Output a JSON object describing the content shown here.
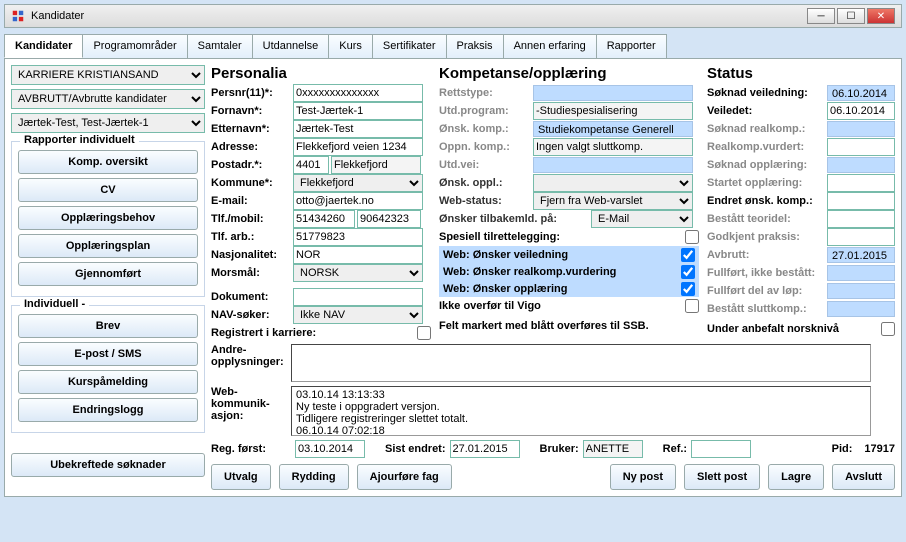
{
  "window": {
    "title": "Kandidater"
  },
  "tabs": [
    "Kandidater",
    "Programområder",
    "Samtaler",
    "Utdannelse",
    "Kurs",
    "Sertifikater",
    "Praksis",
    "Annen erfaring",
    "Rapporter"
  ],
  "active_tab": 0,
  "left_selects": [
    "KARRIERE KRISTIANSAND",
    "AVBRUTT/Avbrutte kandidater",
    "Jærtek-Test, Test-Jærtek-1"
  ],
  "report_group": {
    "title": "Rapporter individuelt",
    "buttons": [
      "Komp. oversikt",
      "CV",
      "Opplæringsbehov",
      "Opplæringsplan",
      "Gjennomført"
    ]
  },
  "indiv_group": {
    "title": "Individuell -",
    "buttons": [
      "Brev",
      "E-post / SMS",
      "Kurspåmelding",
      "Endringslogg"
    ]
  },
  "ubekreft_btn": "Ubekreftede søknader",
  "personalia": {
    "title": "Personalia",
    "persnr_label": "Persnr(11)*:",
    "persnr": "0xxxxxxxxxxxxxx",
    "fornavn_label": "Fornavn*:",
    "fornavn": "Test-Jærtek-1",
    "etternavn_label": "Etternavn*:",
    "etternavn": "Jærtek-Test",
    "adresse_label": "Adresse:",
    "adresse": "Flekkefjord veien 1234",
    "postadr_label": "Postadr.*:",
    "postnr": "4401",
    "poststed": "Flekkefjord",
    "kommune_label": "Kommune*:",
    "kommune": "Flekkefjord",
    "email_label": "E-mail:",
    "email": "otto@jaertek.no",
    "tlfmobil_label": "Tlf./mobil:",
    "tlf": "51434260",
    "mobil": "90642323",
    "tlfarb_label": "Tlf. arb.:",
    "tlfarb": "51779823",
    "nasj_label": "Nasjonalitet:",
    "nasj": "NOR",
    "morsmal_label": "Morsmål:",
    "morsmal": "NORSK",
    "dokument_label": "Dokument:",
    "dokument": "",
    "nav_label": "NAV-søker:",
    "nav": "Ikke NAV",
    "reg_label": "Registrert i karriere:",
    "andre_label1": "Andre-",
    "andre_label2": "opplysninger:",
    "andre": "",
    "web_label1": "Web-",
    "web_label2": "kommunik-",
    "web_label3": "asjon:",
    "web_text": "03.10.14 13:13:33\nNy teste i oppgradert versjon.\nTidligere registreringer slettet totalt.\n06.10.14 07:02:18"
  },
  "kompetanse": {
    "title": "Kompetanse/opplæring",
    "rettstype_label": "Rettstype:",
    "utdprogram_label": "Utd.program:",
    "utdprogram": "-Studiespesialisering",
    "onskkomp_label": "Ønsk. komp.:",
    "onskkomp": "Studiekompetanse Generell",
    "oppnkomp_label": "Oppn. komp.:",
    "oppnkomp": "Ingen valgt sluttkomp.",
    "utdvei_label": "Utd.vei:",
    "onskoppl_label": "Ønsk. oppl.:",
    "webstatus_label": "Web-status:",
    "webstatus": "Fjern fra Web-varslet",
    "onsktil_label": "Ønsker tilbakemld. på:",
    "onsktil": "E-Mail",
    "spesiell_label": "Spesiell tilrettelegging:",
    "web_veil": "Web: Ønsker veiledning",
    "web_real": "Web: Ønsker realkomp.vurdering",
    "web_oppl": "Web: Ønsker opplæring",
    "ikke_vigo": "Ikke overfør til Vigo",
    "ssb_note": "Felt markert med blått overføres til SSB."
  },
  "status": {
    "title": "Status",
    "soknad_veil_label": "Søknad veiledning:",
    "soknad_veil": "06.10.2014",
    "veiledet_label": "Veiledet:",
    "veiledet": "06.10.2014",
    "soknad_real_label": "Søknad realkomp.:",
    "realkomp_vurdert_label": "Realkomp.vurdert:",
    "soknad_oppl_label": "Søknad opplæring:",
    "startet_label": "Startet opplæring:",
    "endret_onsk_label": "Endret ønsk. komp.:",
    "bestatt_teori_label": "Bestått teoridel:",
    "godkj_praksis_label": "Godkjent praksis:",
    "avbrutt_label": "Avbrutt:",
    "avbrutt": "27.01.2015",
    "fullfort_ikke_label": "Fullført, ikke bestått:",
    "fullfort_del_label": "Fullført del av løp:",
    "bestatt_slutt_label": "Bestått sluttkomp.:",
    "under_norsk_label": "Under anbefalt norsknivå"
  },
  "footer": {
    "reg_forst_label": "Reg. først:",
    "reg_forst": "03.10.2014",
    "sist_endret_label": "Sist endret:",
    "sist_endret": "27.01.2015",
    "bruker_label": "Bruker:",
    "bruker": "ANETTE",
    "ref_label": "Ref.:",
    "ref": "",
    "pid_label": "Pid:",
    "pid": "17917"
  },
  "bottom_buttons": {
    "utvalg": "Utvalg",
    "rydding": "Rydding",
    "ajourfore": "Ajourføre fag",
    "ny_post": "Ny post",
    "slett_post": "Slett post",
    "lagre": "Lagre",
    "avslutt": "Avslutt"
  }
}
